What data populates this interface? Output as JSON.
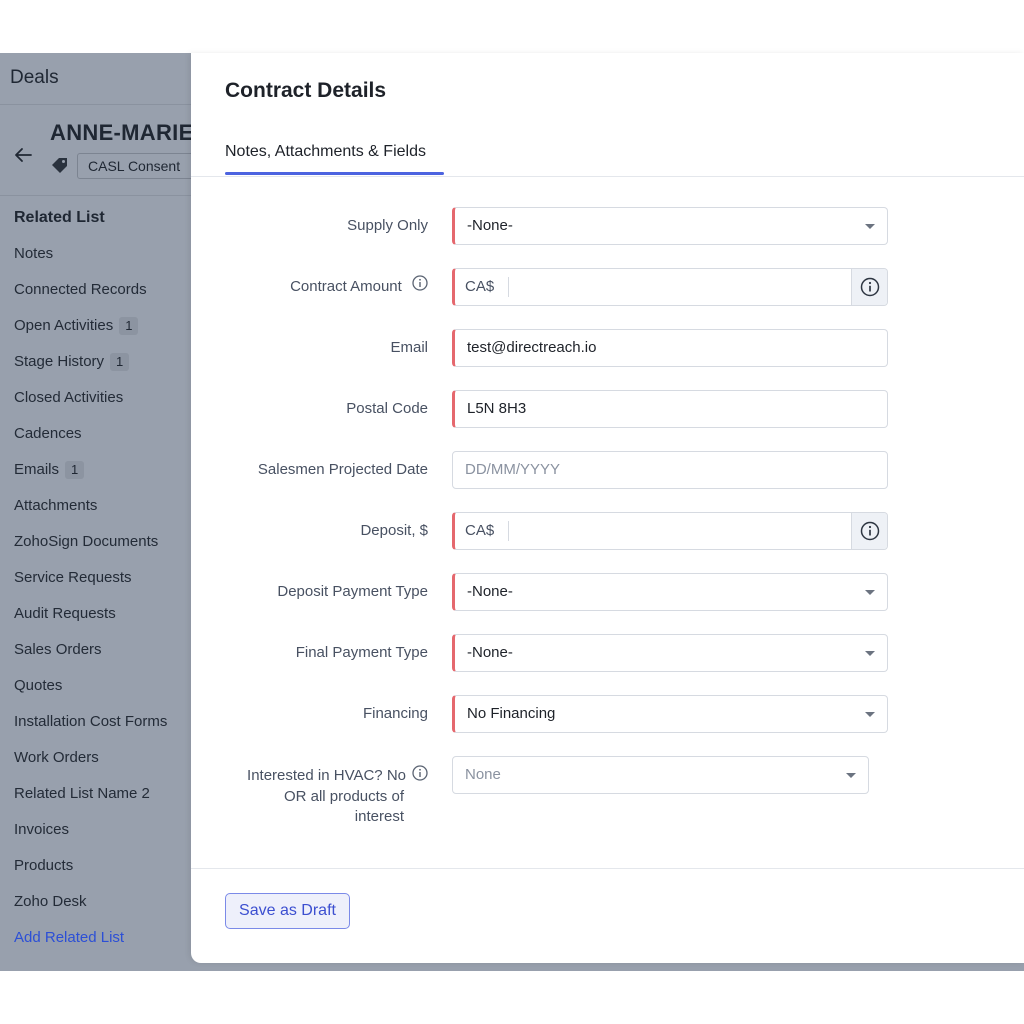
{
  "background": {
    "module_title": "Deals",
    "record_name": "ANNE-MARIE",
    "tag_label": "CASL Consent",
    "related_list_title": "Related List",
    "related_items": [
      {
        "label": "Notes",
        "count": ""
      },
      {
        "label": "Connected Records",
        "count": ""
      },
      {
        "label": "Open Activities",
        "count": "1"
      },
      {
        "label": "Stage History",
        "count": "1"
      },
      {
        "label": "Closed Activities",
        "count": ""
      },
      {
        "label": "Cadences",
        "count": ""
      },
      {
        "label": "Emails",
        "count": "1"
      },
      {
        "label": "Attachments",
        "count": ""
      },
      {
        "label": "ZohoSign Documents",
        "count": ""
      },
      {
        "label": "Service Requests",
        "count": ""
      },
      {
        "label": "Audit Requests",
        "count": ""
      },
      {
        "label": "Sales Orders",
        "count": ""
      },
      {
        "label": "Quotes",
        "count": ""
      },
      {
        "label": "Installation Cost Forms",
        "count": ""
      },
      {
        "label": "Work Orders",
        "count": ""
      },
      {
        "label": "Related List Name 2",
        "count": ""
      },
      {
        "label": "Invoices",
        "count": ""
      },
      {
        "label": "Products",
        "count": ""
      },
      {
        "label": "Zoho Desk",
        "count": ""
      }
    ],
    "add_related_list": "Add Related List"
  },
  "modal": {
    "title": "Contract Details",
    "tab_label": "Notes, Attachments & Fields",
    "fields": {
      "supply_only": {
        "label": "Supply Only",
        "value": "-None-"
      },
      "contract_amount": {
        "label": "Contract Amount",
        "prefix": "CA$",
        "value": ""
      },
      "email": {
        "label": "Email",
        "value": "test@directreach.io"
      },
      "postal_code": {
        "label": "Postal Code",
        "value": "L5N 8H3"
      },
      "salesmen_projected_date": {
        "label": "Salesmen Projected Date",
        "placeholder": "DD/MM/YYYY"
      },
      "deposit": {
        "label": "Deposit, $",
        "prefix": "CA$",
        "value": ""
      },
      "deposit_payment_type": {
        "label": "Deposit Payment Type",
        "value": "-None-"
      },
      "final_payment_type": {
        "label": "Final Payment Type",
        "value": "-None-"
      },
      "financing": {
        "label": "Financing",
        "value": "No Financing"
      },
      "interested_hvac": {
        "label_line1": "Interested in HVAC? No",
        "label_line2": "OR all products of",
        "label_line3": "interest",
        "placeholder": "None"
      }
    },
    "save_draft_label": "Save as Draft"
  },
  "colors": {
    "accent": "#4c63e0",
    "required_marker": "#e5686e",
    "overlay": "#98a0ad"
  }
}
